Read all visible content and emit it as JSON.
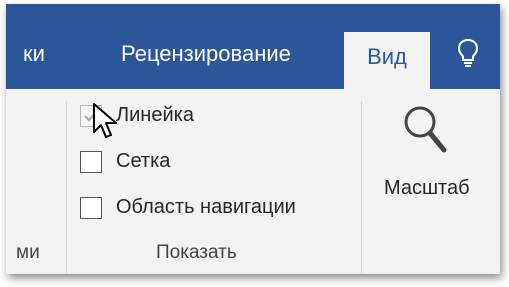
{
  "tabs": {
    "partial_left": "ки",
    "review": "Рецензирование",
    "view": "Вид"
  },
  "show_group": {
    "items": [
      {
        "label": "Линейка",
        "checked": true
      },
      {
        "label": "Сетка",
        "checked": false
      },
      {
        "label": "Область навигации",
        "checked": false
      }
    ],
    "title": "Показать"
  },
  "zoom": {
    "label": "Масштаб"
  },
  "partial_group_label": "ми",
  "icons": {
    "lightbulb": "lightbulb-icon",
    "zoom": "magnifier-icon",
    "cursor": "mouse-pointer-icon"
  },
  "colors": {
    "ribbon_blue": "#2b579a",
    "ribbon_bg": "#f3f3f3",
    "text": "#262626"
  }
}
